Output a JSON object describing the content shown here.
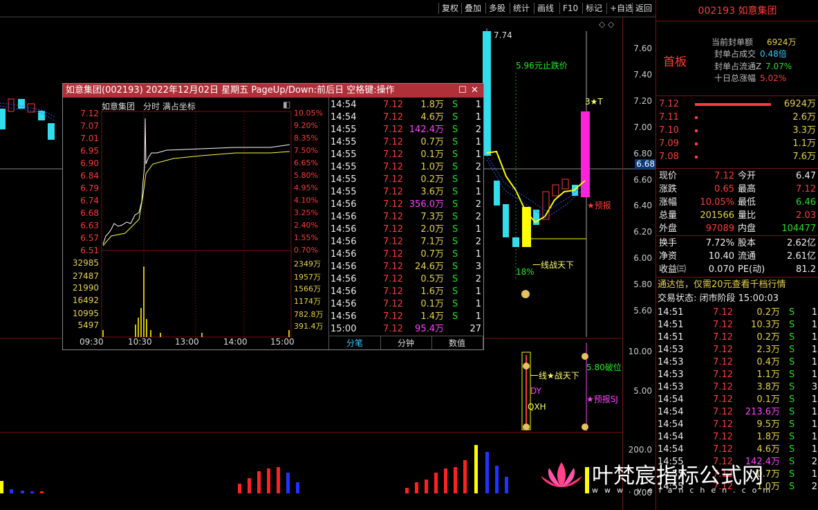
{
  "toolbar": [
    "复权",
    "叠加",
    "多股",
    "统计",
    "画线",
    "F10",
    "标记",
    "+自选",
    "返回"
  ],
  "main_chart": {
    "y_labels": [
      "7.60",
      "7.40",
      "7.20",
      "7.00",
      "6.80",
      "6.60",
      "6.40",
      "6.20",
      "6.00",
      "5.80",
      "5.60"
    ],
    "current_price_tag": "6.68",
    "annotations": {
      "top_price": "7.74",
      "stop_text": "5.96元止跌价",
      "line_text": "一线战天下",
      "pct_text": "18%",
      "warn_text": "★预报",
      "star_text": "3★T"
    },
    "lower_labels": [
      "10.00",
      "5.00"
    ],
    "lower_annotations": {
      "line_text": "一线★战天下",
      "dy": "DY",
      "qxh": "QXH",
      "break_text": "5.80破位",
      "warn_text": "★预报SJ"
    },
    "vol_labels": [
      "200.0",
      "0.00"
    ]
  },
  "popup": {
    "title": "如意集团(002193) 2022年12月02日 星期五 PageUp/Down:前后日 空格键:操作",
    "sub_title_name": "如意集团",
    "sub_title_mode": "分时 满占坐标",
    "left_labels": [
      "7.12",
      "7.07",
      "7.01",
      "6.95",
      "6.90",
      "6.84",
      "6.79",
      "6.74",
      "6.68",
      "6.63",
      "6.57",
      "6.51"
    ],
    "right_labels": [
      "10.05%",
      "9.20%",
      "8.35%",
      "7.50%",
      "6.65%",
      "5.80%",
      "4.95%",
      "4.10%",
      "3.25%",
      "2.40%",
      "1.55%",
      "0.70%"
    ],
    "vol_left": [
      "32985",
      "27487",
      "21990",
      "16492",
      "10995",
      "5497"
    ],
    "vol_right": [
      "2349万",
      "1957万",
      "1566万",
      "1174万",
      "782.8万",
      "391.4万"
    ],
    "x_labels": [
      "09:30",
      "10:30",
      "13:00",
      "14:00",
      "15:00"
    ],
    "ticks": [
      [
        "14:54",
        "7.12",
        "1.8万",
        "S",
        "1"
      ],
      [
        "14:54",
        "7.12",
        "4.6万",
        "S",
        "1"
      ],
      [
        "14:55",
        "7.12",
        "142.4万",
        "S",
        "2"
      ],
      [
        "14:55",
        "7.12",
        "0.7万",
        "S",
        "1"
      ],
      [
        "14:55",
        "7.12",
        "0.1万",
        "S",
        "1"
      ],
      [
        "14:55",
        "7.12",
        "1.0万",
        "S",
        "2"
      ],
      [
        "14:55",
        "7.12",
        "0.2万",
        "S",
        "1"
      ],
      [
        "14:55",
        "7.12",
        "3.6万",
        "S",
        "1"
      ],
      [
        "14:56",
        "7.12",
        "356.0万",
        "S",
        "2"
      ],
      [
        "14:56",
        "7.12",
        "7.3万",
        "S",
        "2"
      ],
      [
        "14:56",
        "7.12",
        "2.0万",
        "S",
        "1"
      ],
      [
        "14:56",
        "7.12",
        "7.1万",
        "S",
        "2"
      ],
      [
        "14:56",
        "7.12",
        "0.7万",
        "S",
        "1"
      ],
      [
        "14:56",
        "7.12",
        "24.6万",
        "S",
        "3"
      ],
      [
        "14:56",
        "7.12",
        "0.5万",
        "S",
        "2"
      ],
      [
        "14:56",
        "7.12",
        "1.6万",
        "S",
        "1"
      ],
      [
        "14:56",
        "7.12",
        "0.1万",
        "S",
        "1"
      ],
      [
        "14:56",
        "7.12",
        "1.4万",
        "S",
        "1"
      ],
      [
        "15:00",
        "7.12",
        "95.4万",
        "",
        "27"
      ]
    ],
    "tabs": [
      "分笔",
      "分钟",
      "数值"
    ]
  },
  "right_panel": {
    "code_name": "002193 如意集团",
    "board": "首板",
    "seal_amount_label": "当前封单额",
    "seal_amount": "6924万",
    "seal_ratio_label": "封单占成交",
    "seal_ratio": "0.48倍",
    "seal_float_label": "封单占流通Z",
    "seal_float": "7.07%",
    "ten_day_label": "十日总涨幅",
    "ten_day": "5.02%",
    "bids": [
      [
        "7.12",
        "6924万"
      ],
      [
        "7.11",
        "2.6万"
      ],
      [
        "7.10",
        "3.3万"
      ],
      [
        "7.09",
        "1.1万"
      ],
      [
        "7.08",
        "7.6万"
      ]
    ],
    "quote": [
      [
        "现价",
        "7.12",
        "今开",
        "6.47"
      ],
      [
        "涨跌",
        "0.65",
        "最高",
        "7.12"
      ],
      [
        "涨幅",
        "10.05%",
        "最低",
        "6.46"
      ],
      [
        "总量",
        "201566",
        "量比",
        "2.03"
      ],
      [
        "外盘",
        "97089",
        "内盘",
        "104477"
      ]
    ],
    "quote2": [
      [
        "换手",
        "7.72%",
        "股本",
        "2.62亿"
      ],
      [
        "净资",
        "10.40",
        "流通",
        "2.61亿"
      ],
      [
        "收益㈢",
        "0.070",
        "PE(动)",
        "81.2"
      ]
    ],
    "promo": "通达信，仅需20元查看千档行情",
    "status": "交易状态: 闭市阶段 15:00:03",
    "ticks": [
      [
        "14:51",
        "7.12",
        "0.2万",
        "S",
        "1"
      ],
      [
        "14:51",
        "7.12",
        "10.3万",
        "S",
        "1"
      ],
      [
        "14:51",
        "7.12",
        "0.2万",
        "S",
        "1"
      ],
      [
        "14:53",
        "7.12",
        "2.3万",
        "S",
        "1"
      ],
      [
        "14:53",
        "7.12",
        "0.4万",
        "S",
        "1"
      ],
      [
        "14:53",
        "7.12",
        "1.1万",
        "S",
        "1"
      ],
      [
        "14:53",
        "7.12",
        "3.8万",
        "S",
        "3"
      ],
      [
        "14:54",
        "7.12",
        "0.1万",
        "S",
        "1"
      ],
      [
        "14:54",
        "7.12",
        "213.6万",
        "S",
        "1"
      ],
      [
        "14:54",
        "7.12",
        "9.5万",
        "S",
        "1"
      ],
      [
        "14:54",
        "7.12",
        "1.8万",
        "S",
        "1"
      ],
      [
        "14:54",
        "7.12",
        "4.6万",
        "S",
        "1"
      ],
      [
        "14:55",
        "7.12",
        "142.4万",
        "S",
        "2"
      ],
      [
        "14:55",
        "7.12",
        "0.7万",
        "S",
        "1"
      ],
      [
        "14:55",
        "7.12",
        "1.0万",
        "S",
        "2"
      ]
    ]
  },
  "watermark": {
    "title": "叶梵宸指标公式网",
    "url": "www.yefanchen.com"
  }
}
